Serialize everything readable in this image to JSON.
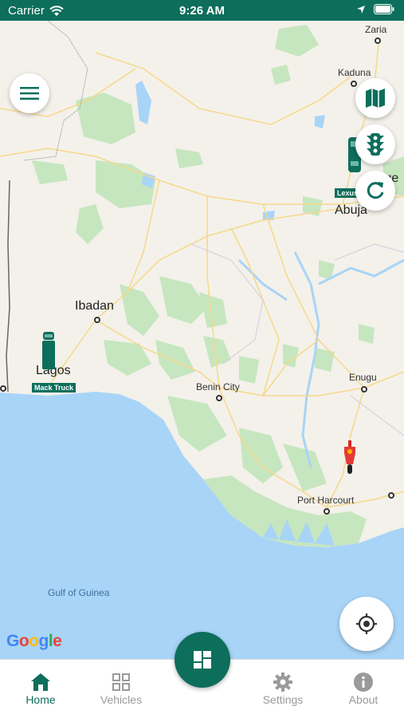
{
  "status_bar": {
    "carrier": "Carrier",
    "time": "9:26 AM"
  },
  "map": {
    "cities": {
      "zaria": "Zaria",
      "kaduna": "Kaduna",
      "abuja": "Abuja",
      "ibadan": "Ibadan",
      "lagos": "Lagos",
      "benin_city": "Benin City",
      "enugu": "Enugu",
      "port_harcourt": "Port Harcourt",
      "niger_partial": "Ige"
    },
    "water": {
      "gulf": "Gulf of Guinea"
    },
    "vehicle_tags": {
      "mack": "Mack Truck",
      "lexus": "Lexus"
    },
    "google_logo": "Google"
  },
  "tabs": {
    "home": "Home",
    "vehicles": "Vehicles",
    "settings": "Settings",
    "about": "About"
  },
  "colors": {
    "brand": "#0d6e5c",
    "inactive": "#9a9a9a",
    "water": "#a8d4f7",
    "land": "#f3f1ea",
    "park": "#c6e6bf",
    "road": "#f7d88a"
  }
}
